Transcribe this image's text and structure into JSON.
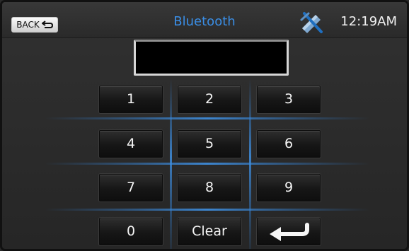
{
  "header": {
    "back_label": "BACK",
    "title": "Bluetooth",
    "clock": "12:19AM",
    "icons": {
      "back": "return-arrow-icon",
      "bluetooth_status": "bluetooth-disconnected-icon"
    }
  },
  "dialpad": {
    "display_value": "",
    "keys": [
      "1",
      "2",
      "3",
      "4",
      "5",
      "6",
      "7",
      "8",
      "9",
      "0",
      "Clear"
    ],
    "enter_icon": "enter-arrow-icon"
  },
  "colors": {
    "accent": "#3a8ee6",
    "background": "#2a2a2a",
    "display": "#000000",
    "glow": "#2f78c8"
  }
}
